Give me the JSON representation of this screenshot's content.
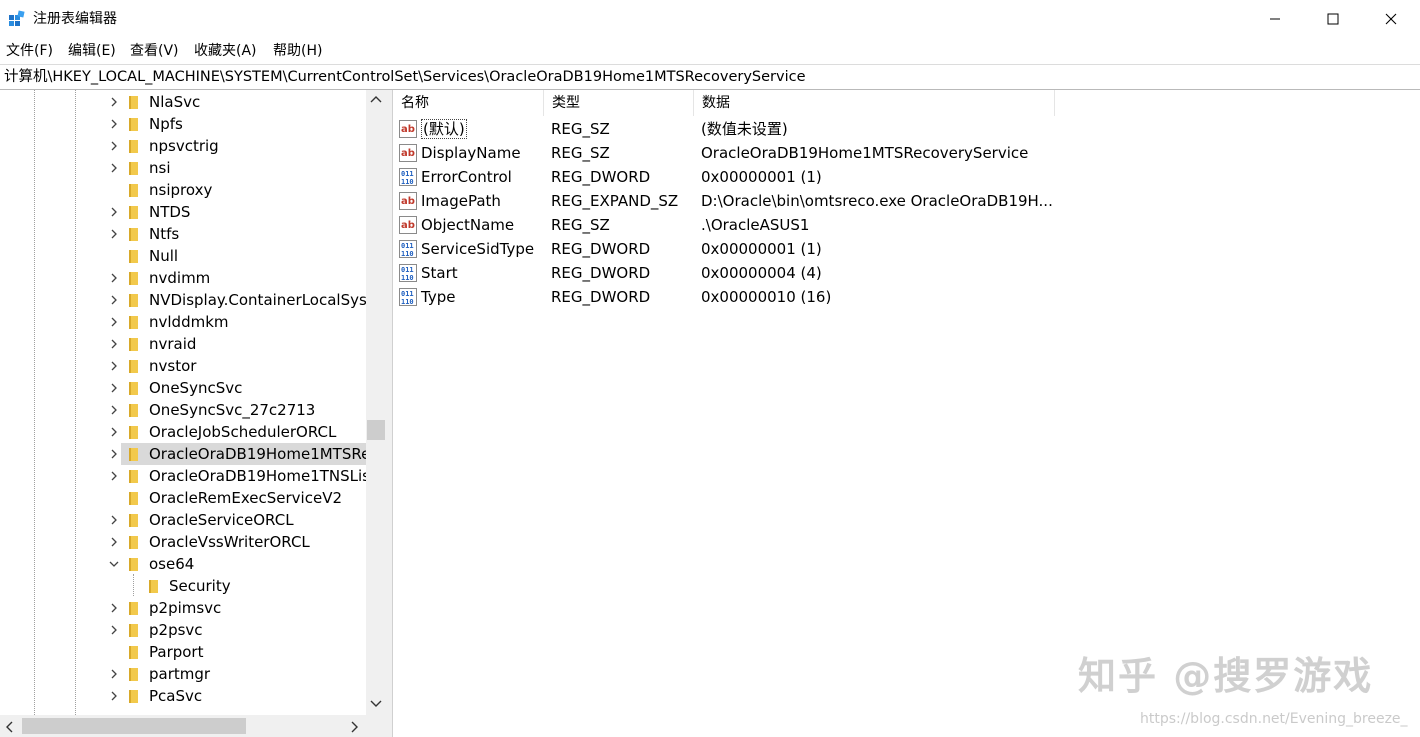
{
  "window": {
    "title": "注册表编辑器",
    "controls": {
      "minimize_icon": "minimize-icon",
      "maximize_icon": "maximize-icon",
      "close_icon": "close-icon"
    }
  },
  "menu": {
    "items": [
      {
        "label": "文件(F)"
      },
      {
        "label": "编辑(E)"
      },
      {
        "label": "查看(V)"
      },
      {
        "label": "收藏夹(A)"
      },
      {
        "label": "帮助(H)"
      }
    ]
  },
  "address": {
    "path": "计算机\\HKEY_LOCAL_MACHINE\\SYSTEM\\CurrentControlSet\\Services\\OracleOraDB19Home1MTSRecoveryService"
  },
  "tree": {
    "items": [
      {
        "label": "NlaSvc",
        "expander": "collapsed",
        "level": 0
      },
      {
        "label": "Npfs",
        "expander": "collapsed",
        "level": 0
      },
      {
        "label": "npsvctrig",
        "expander": "collapsed",
        "level": 0
      },
      {
        "label": "nsi",
        "expander": "collapsed",
        "level": 0
      },
      {
        "label": "nsiproxy",
        "expander": "none",
        "level": 0
      },
      {
        "label": "NTDS",
        "expander": "collapsed",
        "level": 0
      },
      {
        "label": "Ntfs",
        "expander": "collapsed",
        "level": 0
      },
      {
        "label": "Null",
        "expander": "none",
        "level": 0
      },
      {
        "label": "nvdimm",
        "expander": "collapsed",
        "level": 0
      },
      {
        "label": "NVDisplay.ContainerLocalSyst",
        "expander": "collapsed",
        "level": 0
      },
      {
        "label": "nvlddmkm",
        "expander": "collapsed",
        "level": 0
      },
      {
        "label": "nvraid",
        "expander": "collapsed",
        "level": 0
      },
      {
        "label": "nvstor",
        "expander": "collapsed",
        "level": 0
      },
      {
        "label": "OneSyncSvc",
        "expander": "collapsed",
        "level": 0
      },
      {
        "label": "OneSyncSvc_27c2713",
        "expander": "collapsed",
        "level": 0
      },
      {
        "label": "OracleJobSchedulerORCL",
        "expander": "collapsed",
        "level": 0
      },
      {
        "label": "OracleOraDB19Home1MTSRe",
        "expander": "collapsed",
        "level": 0,
        "selected": true
      },
      {
        "label": "OracleOraDB19Home1TNSLis",
        "expander": "collapsed",
        "level": 0
      },
      {
        "label": "OracleRemExecServiceV2",
        "expander": "none",
        "level": 0
      },
      {
        "label": "OracleServiceORCL",
        "expander": "collapsed",
        "level": 0
      },
      {
        "label": "OracleVssWriterORCL",
        "expander": "collapsed",
        "level": 0
      },
      {
        "label": "ose64",
        "expander": "expanded",
        "level": 0
      },
      {
        "label": "Security",
        "expander": "none",
        "level": 1
      },
      {
        "label": "p2pimsvc",
        "expander": "collapsed",
        "level": 0
      },
      {
        "label": "p2psvc",
        "expander": "collapsed",
        "level": 0
      },
      {
        "label": "Parport",
        "expander": "none",
        "level": 0
      },
      {
        "label": "partmgr",
        "expander": "collapsed",
        "level": 0
      },
      {
        "label": "PcaSvc",
        "expander": "collapsed",
        "level": 0
      }
    ]
  },
  "values": {
    "headers": {
      "name": "名称",
      "type": "类型",
      "data": "数据"
    },
    "rows": [
      {
        "name": "(默认)",
        "type": "REG_SZ",
        "data": "(数值未设置)",
        "icon": "string-value-icon",
        "is_default": true
      },
      {
        "name": "DisplayName",
        "type": "REG_SZ",
        "data": "OracleOraDB19Home1MTSRecoveryService",
        "icon": "string-value-icon"
      },
      {
        "name": "ErrorControl",
        "type": "REG_DWORD",
        "data": "0x00000001 (1)",
        "icon": "binary-value-icon"
      },
      {
        "name": "ImagePath",
        "type": "REG_EXPAND_SZ",
        "data": "D:\\Oracle\\bin\\omtsreco.exe OracleOraDB19H...",
        "icon": "string-value-icon"
      },
      {
        "name": "ObjectName",
        "type": "REG_SZ",
        "data": ".\\OracleASUS1",
        "icon": "string-value-icon"
      },
      {
        "name": "ServiceSidType",
        "type": "REG_DWORD",
        "data": "0x00000001 (1)",
        "icon": "binary-value-icon"
      },
      {
        "name": "Start",
        "type": "REG_DWORD",
        "data": "0x00000004 (4)",
        "icon": "binary-value-icon"
      },
      {
        "name": "Type",
        "type": "REG_DWORD",
        "data": "0x00000010 (16)",
        "icon": "binary-value-icon"
      }
    ]
  },
  "watermark": {
    "main": "知乎 @搜罗游戏",
    "url": "https://blog.csdn.net/Evening_breeze_"
  },
  "colors": {
    "folder": "#f2c94c",
    "selected_bg": "#d9d9d9",
    "ab_icon_red": "#c0392b",
    "binary_icon_blue": "#1f5fbf"
  }
}
